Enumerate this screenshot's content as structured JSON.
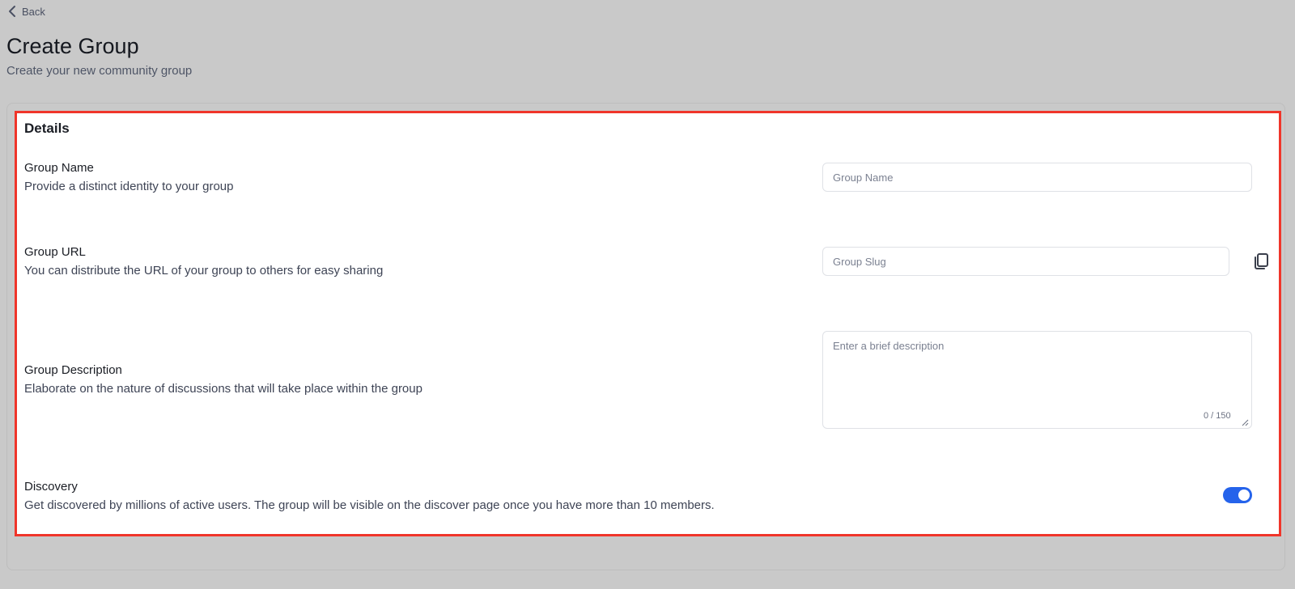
{
  "header": {
    "back_label": "Back",
    "title": "Create Group",
    "subtitle": "Create your new community group"
  },
  "details": {
    "section_title": "Details",
    "group_name": {
      "label": "Group Name",
      "description": "Provide a distinct identity to your group",
      "placeholder": "Group Name",
      "value": ""
    },
    "group_url": {
      "label": "Group URL",
      "description": "You can distribute the URL of your group to others for easy sharing",
      "placeholder": "Group Slug",
      "value": "",
      "copy_icon": "copy-icon"
    },
    "group_description": {
      "label": "Group Description",
      "description": "Elaborate on the nature of discussions that will take place within the group",
      "placeholder": "Enter a brief description",
      "value": "",
      "counter": "0 / 150"
    },
    "discovery": {
      "label": "Discovery",
      "description": "Get discovered by millions of active users. The group will be visible on the discover page once you have more than 10 members.",
      "enabled": true
    }
  },
  "colors": {
    "background": "#c9c9c9",
    "panel": "#ffffff",
    "highlight_border": "#f0352a",
    "toggle_on": "#2563eb"
  }
}
